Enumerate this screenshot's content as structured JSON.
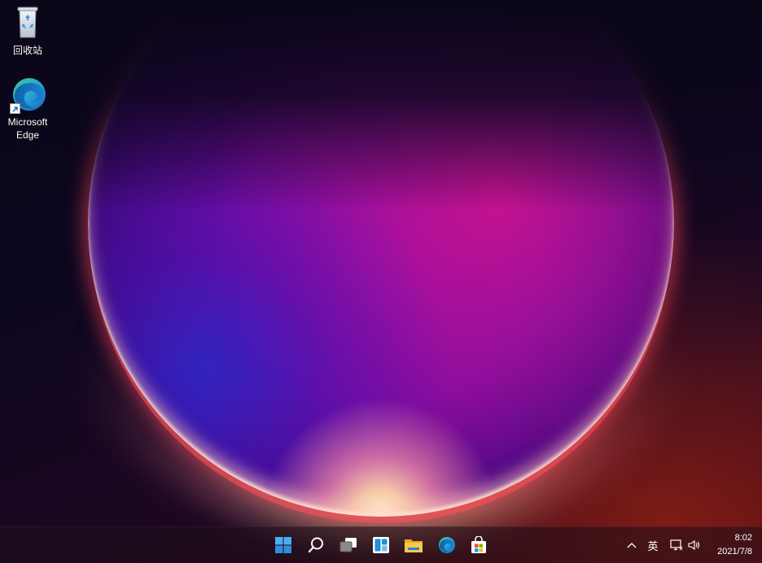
{
  "desktop": {
    "icons": [
      {
        "label": "回收站",
        "icon": "recycle-bin-icon"
      },
      {
        "label": "Microsoft\nEdge",
        "icon": "edge-icon",
        "shortcut": true
      }
    ]
  },
  "taskbar": {
    "pinned": [
      {
        "name": "start",
        "icon": "windows-logo-icon"
      },
      {
        "name": "search",
        "icon": "search-icon"
      },
      {
        "name": "task-view",
        "icon": "task-view-icon"
      },
      {
        "name": "widgets",
        "icon": "widgets-icon"
      },
      {
        "name": "file-explorer",
        "icon": "folder-icon"
      },
      {
        "name": "edge",
        "icon": "edge-icon"
      },
      {
        "name": "microsoft-store",
        "icon": "store-icon"
      }
    ],
    "tray": {
      "ime": "英",
      "time": "8:02",
      "date": "2021/7/8"
    }
  },
  "colors": {
    "windows_blue": "#3aa0f0",
    "folder_yellow": "#f5c542",
    "edge_blue": "#1a7fd4",
    "edge_green": "#3ec98a"
  }
}
